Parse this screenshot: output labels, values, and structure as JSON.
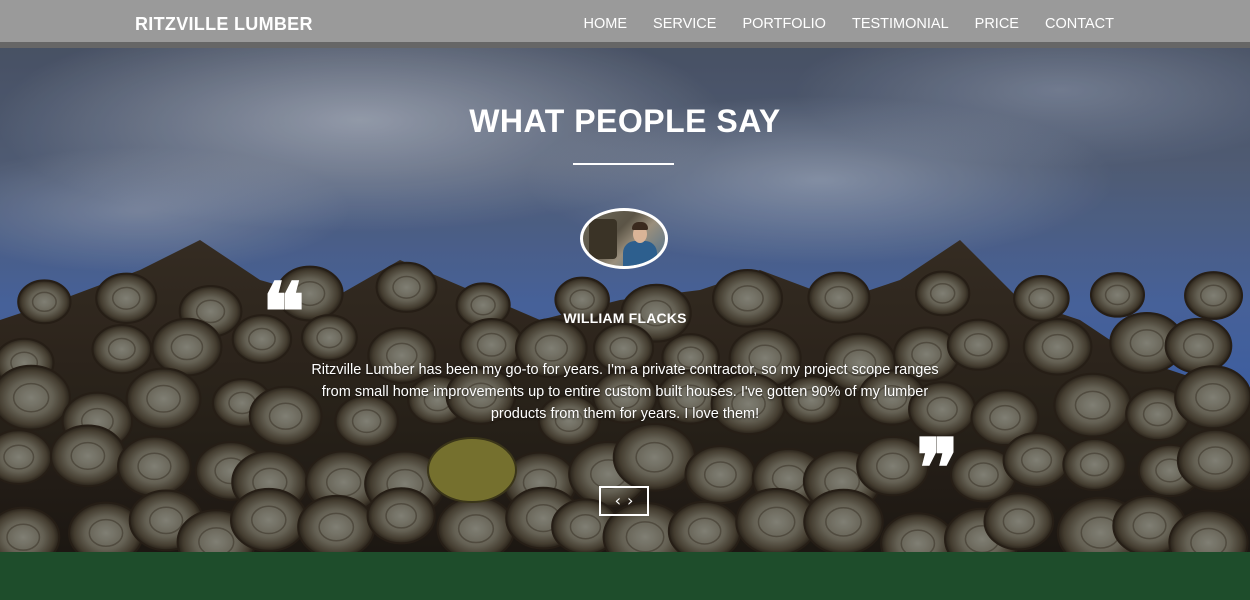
{
  "brand": "RITZVILLE LUMBER",
  "nav": {
    "items": [
      "HOME",
      "SERVICE",
      "PORTFOLIO",
      "TESTIMONIAL",
      "PRICE",
      "CONTACT"
    ]
  },
  "testimonials": {
    "title": "WHAT PEOPLE SAY",
    "author": "WILLIAM FLACKS",
    "text": "Ritzville Lumber has been my go-to for years. I'm a private contractor, so my project scope ranges from small home improvements up to entire custom built houses. I've gotten 90% of my lumber products from them for years. I love them!",
    "quote_open": "❝",
    "quote_close": "❞",
    "prev": "‹",
    "next": "›"
  },
  "colors": {
    "navbar": "#9a9a9a",
    "footer_band": "#1e4d2b"
  },
  "icons": {
    "quote_open": "quote-open-icon",
    "quote_close": "quote-close-icon",
    "prev": "chevron-left-icon",
    "next": "chevron-right-icon"
  }
}
